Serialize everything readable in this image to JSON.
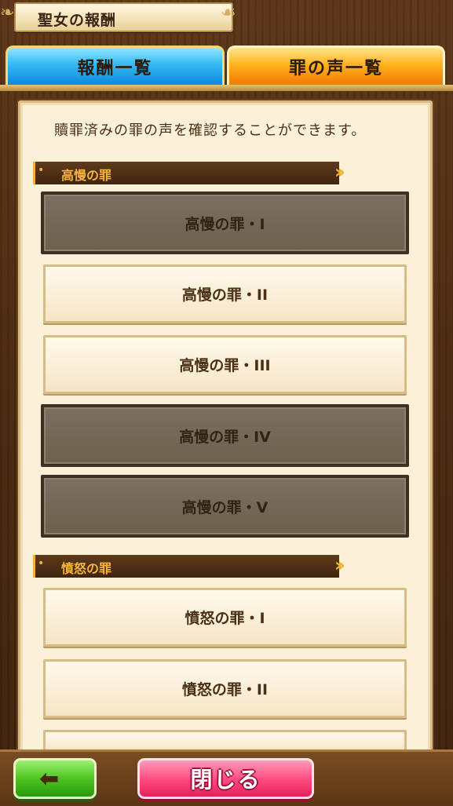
{
  "header": {
    "title": "聖女の報酬"
  },
  "tabs": {
    "rewards_label": "報酬一覧",
    "voices_label": "罪の声一覧"
  },
  "description": "贖罪済みの罪の声を確認することができます。",
  "sections": [
    {
      "title": "高慢の罪",
      "items": [
        {
          "label": "高慢の罪・I",
          "state": "dark"
        },
        {
          "label": "高慢の罪・II",
          "state": "light"
        },
        {
          "label": "高慢の罪・III",
          "state": "light"
        },
        {
          "label": "高慢の罪・IV",
          "state": "dark"
        },
        {
          "label": "高慢の罪・V",
          "state": "dark"
        }
      ]
    },
    {
      "title": "憤怒の罪",
      "items": [
        {
          "label": "憤怒の罪・I",
          "state": "light"
        },
        {
          "label": "憤怒の罪・II",
          "state": "light"
        }
      ]
    }
  ],
  "footer": {
    "back_icon": "left-arrow-icon",
    "close_label": "閉じる"
  },
  "colors": {
    "tab_active": "#f27a06",
    "tab_inactive": "#0f89dc",
    "close_button": "#ff4f83",
    "back_button": "#4dc522"
  }
}
